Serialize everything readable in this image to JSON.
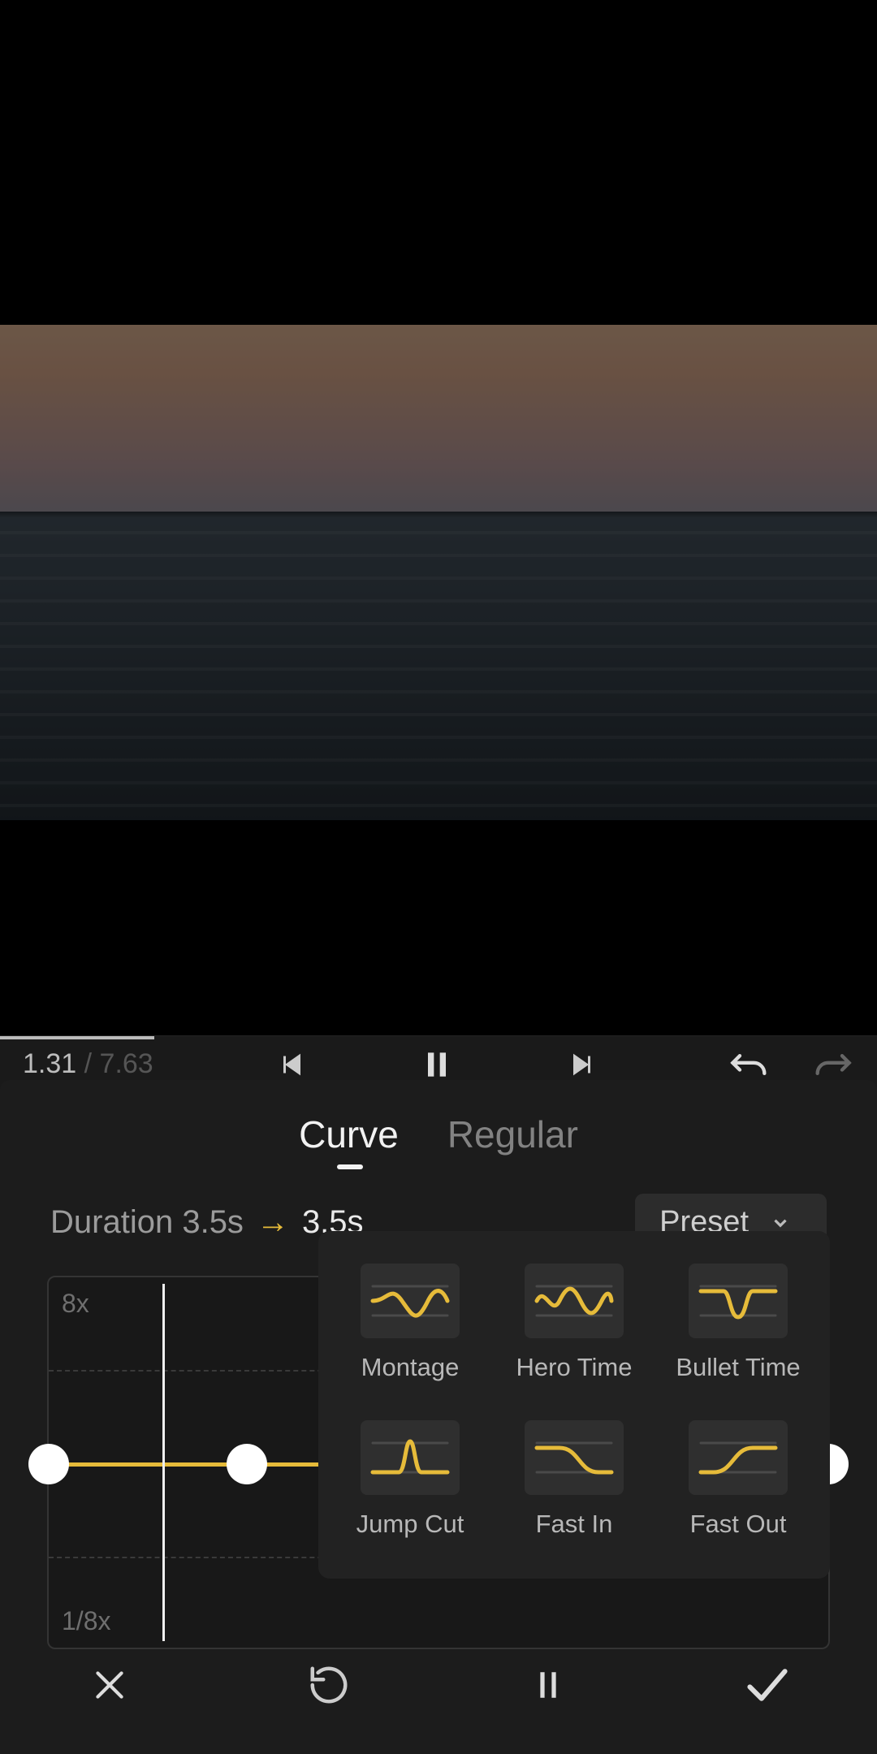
{
  "timeline": {
    "current": "1.31",
    "total": "7.63"
  },
  "tabs": {
    "curve": "Curve",
    "regular": "Regular"
  },
  "duration": {
    "label": "Duration",
    "before": "3.5s",
    "after": "3.5s"
  },
  "preset_button": "Preset",
  "axis": {
    "top": "8x",
    "bottom": "1/8x"
  },
  "presets": [
    {
      "name": "Montage"
    },
    {
      "name": "Hero Time"
    },
    {
      "name": "Bullet Time"
    },
    {
      "name": "Jump Cut"
    },
    {
      "name": "Fast In"
    },
    {
      "name": "Fast Out"
    }
  ],
  "colors": {
    "accent": "#e6bb3a"
  }
}
